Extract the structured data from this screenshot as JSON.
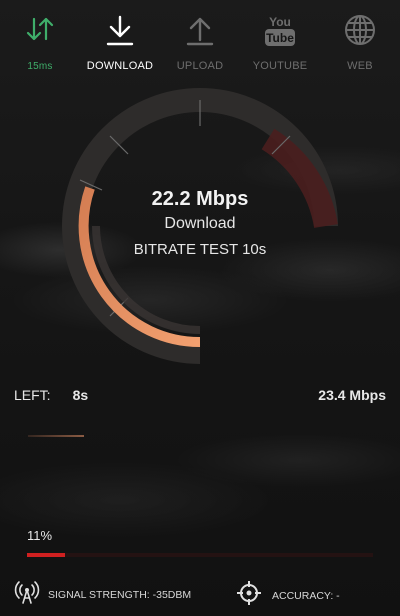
{
  "tabs": [
    {
      "id": "ping",
      "label": "15ms",
      "icon": "up-down-arrows-icon"
    },
    {
      "id": "download",
      "label": "DOWNLOAD",
      "icon": "download-arrow-icon"
    },
    {
      "id": "upload",
      "label": "UPLOAD",
      "icon": "upload-arrow-icon"
    },
    {
      "id": "youtube",
      "label": "YOUTUBE",
      "icon": "youtube-icon"
    },
    {
      "id": "web",
      "label": "WEB",
      "icon": "globe-icon"
    }
  ],
  "youtube_logo_text": {
    "top": "You",
    "bottom": "Tube"
  },
  "gauge": {
    "speed": "22.2 Mbps",
    "direction": "Download",
    "test_name": "BITRATE TEST 10s",
    "fill_color": "#e89060",
    "track_color": "#2e2c2b",
    "accent_color": "#4a1e1e"
  },
  "stats": {
    "left_label": "LEFT:",
    "left_value": "8s",
    "rate": "23.4 Mbps"
  },
  "progress": {
    "label": "11%",
    "value": 0.11,
    "color": "#d02020"
  },
  "footer": {
    "signal_text": "SIGNAL STRENGTH: -35DBM",
    "accuracy_text": "ACCURACY: -"
  },
  "colors": {
    "ping_green": "#3fae6a",
    "inactive_gray": "#6e6e6e",
    "active_white": "#ffffff"
  }
}
